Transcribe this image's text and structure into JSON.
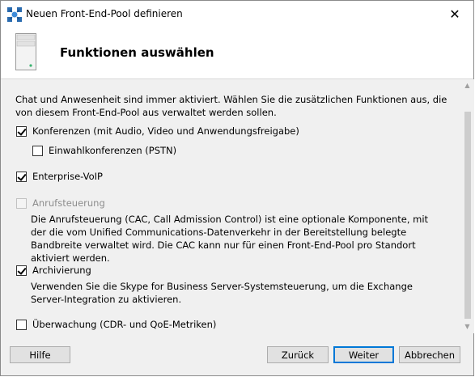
{
  "window": {
    "title": "Neuen Front-End-Pool definieren",
    "close_symbol": "✕"
  },
  "header": {
    "title": "Funktionen auswählen"
  },
  "content": {
    "intro": "Chat und Anwesenheit sind immer aktiviert. Wählen Sie die zusätzlichen Funktionen aus, die von diesem Front-End-Pool aus verwaltet werden sollen.",
    "options": [
      {
        "label": "Konferenzen (mit Audio, Video und Anwendungsfreigabe)",
        "checked": true,
        "enabled": true
      },
      {
        "label": "Einwahlkonferenzen (PSTN)",
        "checked": false,
        "enabled": true
      },
      {
        "label": "Enterprise-VoIP",
        "checked": true,
        "enabled": true
      },
      {
        "label": "Anrufsteuerung",
        "checked": false,
        "enabled": false
      },
      {
        "label": "Archivierung",
        "checked": true,
        "enabled": true
      },
      {
        "label": "Überwachung (CDR- und QoE-Metriken)",
        "checked": false,
        "enabled": true
      }
    ],
    "anrufsteuerung_desc": "Die Anrufsteuerung (CAC, Call Admission Control) ist eine optionale Komponente, mit der die vom Unified Communications-Datenverkehr in der Bereitstellung belegte Bandbreite verwaltet wird. Die CAC kann nur für einen Front-End-Pool pro Standort aktiviert werden.",
    "archivierung_desc": "Verwenden Sie die Skype for Business Server-Systemsteuerung, um die Exchange Server-Integration zu aktivieren."
  },
  "buttons": {
    "help": "Hilfe",
    "back": "Zurück",
    "next": "Weiter",
    "cancel": "Abbrechen"
  },
  "icons": {
    "app": "topology-builder-icon",
    "header": "server-icon"
  }
}
